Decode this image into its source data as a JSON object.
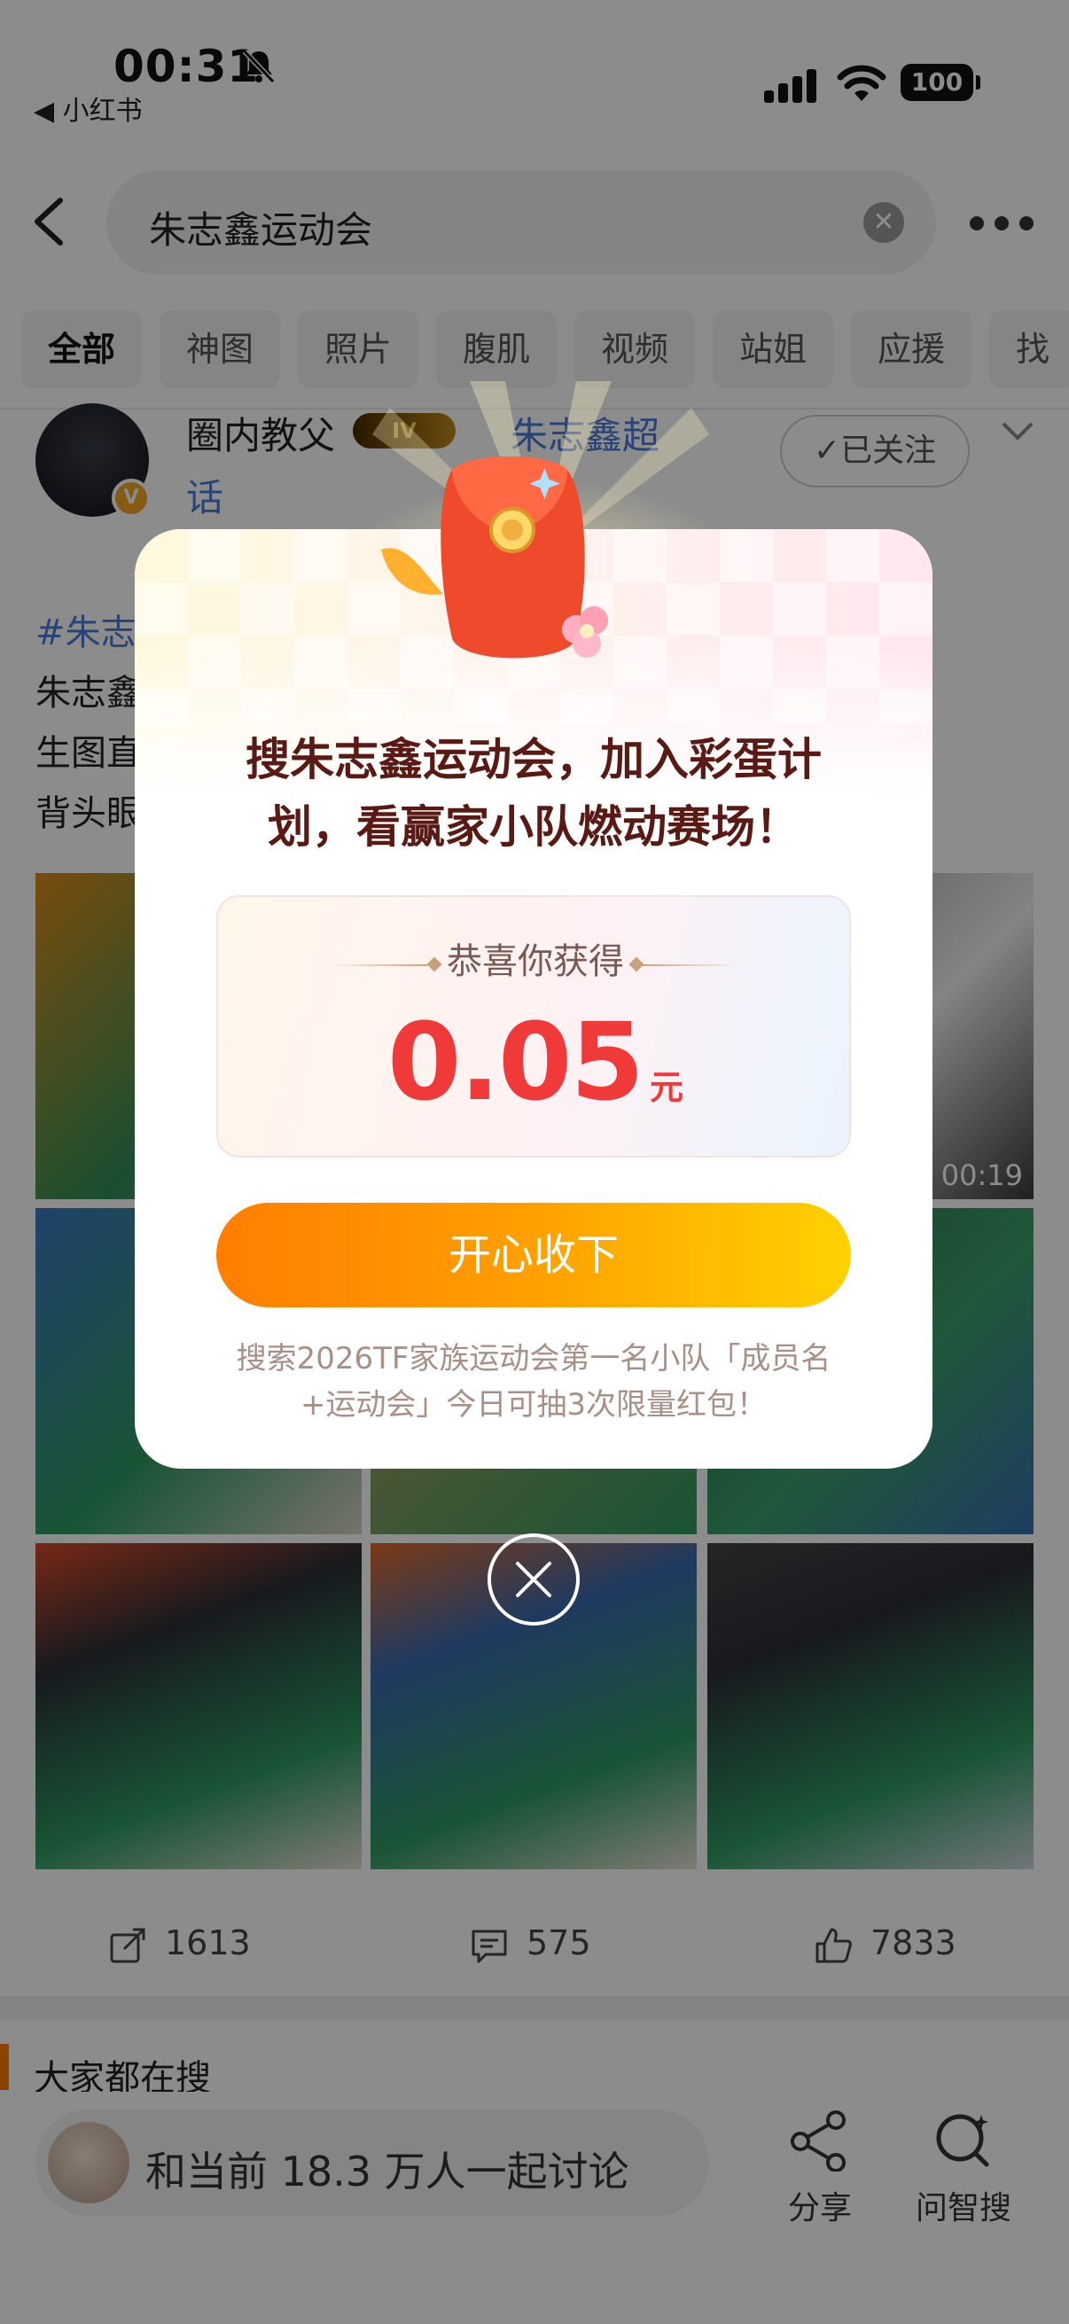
{
  "status_bar": {
    "time": "00:31",
    "back_app": "◀ 小红书",
    "battery": "100"
  },
  "search": {
    "query": "朱志鑫运动会"
  },
  "tabs": [
    "全部",
    "神图",
    "照片",
    "腹肌",
    "视频",
    "站姐",
    "应援",
    "找"
  ],
  "post": {
    "author": "圈内教父",
    "badge": "IV",
    "topic_line1": "朱志鑫超",
    "topic_line2": "话",
    "follow_label": "✓已关注",
    "text_line1": "#朱志",
    "text_line2": "朱志鑫",
    "text_line3": "生图直",
    "text_line4": "背头眼",
    "video_duration": "00:19"
  },
  "actions": {
    "share_count": "1613",
    "comment_count": "575",
    "like_count": "7833"
  },
  "hot_search_title": "大家都在搜",
  "bottom_bar": {
    "discuss_text": "和当前 18.3 万人一起讨论",
    "share_label": "分享",
    "ask_label": "问智搜"
  },
  "modal": {
    "title_line1": "搜朱志鑫运动会，加入彩蛋计",
    "title_line2": "划，看赢家小队燃动赛场！",
    "prize_label": "恭喜你获得",
    "amount": "0.05",
    "unit": "元",
    "accept_label": "开心收下",
    "note_line1": "搜索2026TF家族运动会第一名小队「成员名",
    "note_line2": "+运动会」今日可抽3次限量红包！"
  },
  "colors": {
    "accent_orange": "#ff8a00",
    "amount_red": "#f03a3a",
    "link_blue": "#4a7ad6",
    "title_brown": "#5a1a14"
  }
}
